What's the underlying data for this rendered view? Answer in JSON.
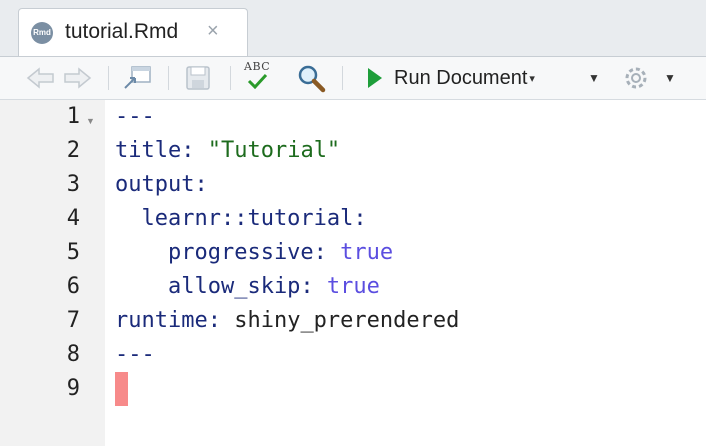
{
  "tab": {
    "badge": "Rmd",
    "filename": "tutorial.Rmd",
    "close": "×"
  },
  "toolbar": {
    "run_label": "Run Document",
    "spellcheck_label": "ABC",
    "icons": [
      "back-arrow-icon",
      "forward-arrow-icon",
      "show-in-window-icon",
      "save-icon",
      "spellcheck-icon",
      "search-icon",
      "run-icon",
      "gear-icon"
    ]
  },
  "editor": {
    "line_numbers": [
      "1",
      "2",
      "3",
      "4",
      "5",
      "6",
      "7",
      "8",
      "9"
    ],
    "lines": [
      [
        {
          "t": "---",
          "c": "key"
        }
      ],
      [
        {
          "t": "title:",
          "c": "key"
        },
        {
          "t": " \"Tutorial\"",
          "c": "str"
        }
      ],
      [
        {
          "t": "output:",
          "c": "key"
        }
      ],
      [
        {
          "t": "  learnr::tutorial:",
          "c": "key"
        }
      ],
      [
        {
          "t": "    progressive:",
          "c": "key"
        },
        {
          "t": " true",
          "c": "bool"
        }
      ],
      [
        {
          "t": "    allow_skip:",
          "c": "key"
        },
        {
          "t": " true",
          "c": "bool"
        }
      ],
      [
        {
          "t": "runtime:",
          "c": "key"
        },
        {
          "t": " shiny_prerendered",
          "c": "plain"
        }
      ],
      [
        {
          "t": "---",
          "c": "key"
        }
      ],
      []
    ],
    "colors": {
      "key": "#1a2a7a",
      "string": "#1d6b1d",
      "boolean": "#5b4ee0",
      "cursor": "#f78a8a"
    }
  }
}
